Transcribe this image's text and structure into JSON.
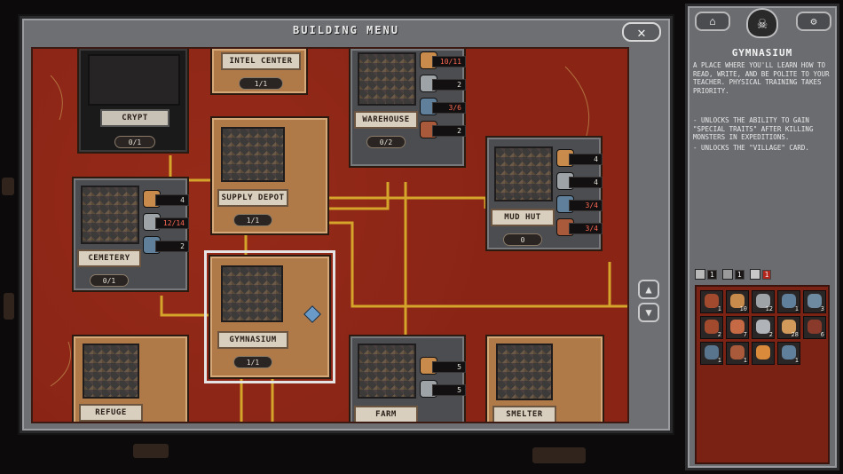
{
  "window": {
    "title": "BUILDING MENU",
    "close_label": "✕"
  },
  "scroll": {
    "up": "▲",
    "down": "▼"
  },
  "buildings": {
    "crypt": {
      "name": "CRYPT",
      "count": "0/1"
    },
    "intel": {
      "name": "INTEL CENTER",
      "count": "1/1"
    },
    "warehouse": {
      "name": "WAREHOUSE",
      "count": "0/2",
      "resources": [
        "10/11",
        "2",
        "3/6",
        "2"
      ]
    },
    "supply": {
      "name": "SUPPLY DEPOT",
      "count": "1/1"
    },
    "mudhut": {
      "name": "MUD HUT",
      "count": "0",
      "resources": [
        "4",
        "4",
        "3/4",
        "3/4"
      ]
    },
    "cemetery": {
      "name": "CEMETERY",
      "count": "0/1",
      "resources": [
        "4",
        "12/14",
        "2"
      ]
    },
    "gymnasium": {
      "name": "GYMNASIUM",
      "count": "1/1"
    },
    "refuge": {
      "name": "REFUGE"
    },
    "farm": {
      "name": "FARM",
      "resources": [
        "5",
        "5"
      ]
    },
    "smelter": {
      "name": "SMELTER"
    }
  },
  "panel": {
    "title": "GYMNASIUM",
    "description": "A PLACE WHERE YOU'LL LEARN HOW TO READ, WRITE, AND BE POLITE TO YOUR TEACHER. PHYSICAL TRAINING TAKES PRIORITY.",
    "effects": [
      "- UNLOCKS THE ABILITY TO GAIN \"SPECIAL TRAITS\" AFTER KILLING MONSTERS IN EXPEDITIONS.",
      "- UNLOCKS THE \"VILLAGE\" CARD."
    ],
    "inventory_header": {
      "a": "1",
      "b": "1",
      "c": "1"
    },
    "inventory": [
      {
        "icon": "food-icon",
        "color": "#a24a2e",
        "qty": "1"
      },
      {
        "icon": "wood-icon",
        "color": "#c98b4c",
        "qty": "10"
      },
      {
        "icon": "stone-icon",
        "color": "#9ea3a8",
        "qty": "12"
      },
      {
        "icon": "metal-icon",
        "color": "#5f7f9b",
        "qty": "1"
      },
      {
        "icon": "gear-icon",
        "color": "#6d8aa0",
        "qty": "3"
      },
      {
        "icon": "food-icon",
        "color": "#a24a2e",
        "qty": "2"
      },
      {
        "icon": "flesh-icon",
        "color": "#c56a45",
        "qty": "7"
      },
      {
        "icon": "stone-icon",
        "color": "#b0b4b8",
        "qty": "2"
      },
      {
        "icon": "wood-icon",
        "color": "#d29a5a",
        "qty": "28"
      },
      {
        "icon": "orb-icon",
        "color": "#8a3a2a",
        "qty": "6"
      },
      {
        "icon": "metal-icon",
        "color": "#59758d",
        "qty": "1"
      },
      {
        "icon": "flesh-icon",
        "color": "#a85a3a",
        "qty": "1"
      },
      {
        "icon": "orb-icon",
        "color": "#d98a3a",
        "qty": ""
      },
      {
        "icon": "metal-icon",
        "color": "#5f7f9b",
        "qty": "1"
      }
    ]
  }
}
